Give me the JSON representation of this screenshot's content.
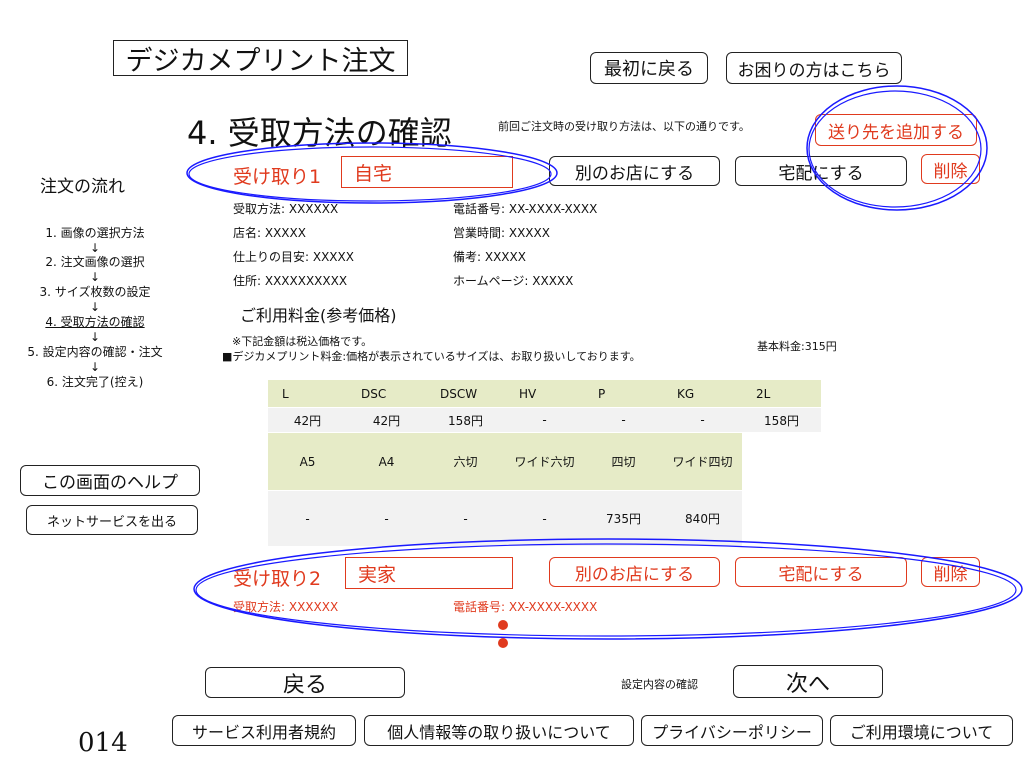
{
  "app": {
    "title": "デジカメプリント注文",
    "page_number": "014"
  },
  "header_nav": {
    "back_to_start": "最初に戻る",
    "help_link": "お困りの方はこちら"
  },
  "page": {
    "heading": "4. 受取方法の確認",
    "note": "前回ご注文時の受け取り方法は、以下の通りです。",
    "add_destination": "送り先を追加する"
  },
  "sidebar": {
    "flow_title": "注文の流れ",
    "steps": [
      "1. 画像の選択方法",
      "2. 注文画像の選択",
      "3. サイズ枚数の設定",
      "4. 受取方法の確認",
      "5. 設定内容の確認・注文",
      "6. 注文完了(控え)"
    ],
    "arrow": "↓",
    "help_button": "この画面のヘルプ",
    "exit_button": "ネットサービスを出る"
  },
  "receipt1": {
    "label": "受け取り1",
    "name_value": "自宅",
    "other_store": "別のお店にする",
    "delivery": "宅配にする",
    "delete": "削除",
    "fields": {
      "method": "受取方法:  XXXXXX",
      "phone": "電話番号:  XX-XXXX-XXXX",
      "store": "店名:  XXXXX",
      "hours": "営業時間:  XXXXX",
      "eta": "仕上りの目安:  XXXXX",
      "remarks": "備考:  XXXXX",
      "address": "住所:  XXXXXXXXXX",
      "homepage": "ホームページ:  XXXXX"
    }
  },
  "pricing": {
    "title": "ご利用料金(参考価格)",
    "note1": "※下記金額は税込価格です。",
    "note2": "■デジカメプリント料金:価格が表示されているサイズは、お取り扱いしております。",
    "base_fee": "基本料金:315円",
    "row1_headers": [
      "L",
      "DSC",
      "DSCW",
      "HV",
      "P",
      "KG",
      "2L"
    ],
    "row1_values": [
      "42円",
      "42円",
      "158円",
      "-",
      "-",
      "-",
      "158円"
    ],
    "row2_headers": [
      "A5",
      "A4",
      "六切",
      "ワイド六切",
      "四切",
      "ワイド四切"
    ],
    "row2_values": [
      "-",
      "-",
      "-",
      "-",
      "735円",
      "840円"
    ]
  },
  "receipt2": {
    "label": "受け取り2",
    "name_value": "実家",
    "other_store": "別のお店にする",
    "delivery": "宅配にする",
    "delete": "削除",
    "method": "受取方法:  XXXXXX",
    "phone": "電話番号:  XX-XXXX-XXXX"
  },
  "footer": {
    "back": "戻る",
    "confirm_label": "設定内容の確認",
    "next": "次へ",
    "links": [
      "サービス利用者規約",
      "個人情報等の取り扱いについて",
      "プライバシーポリシー",
      "ご利用環境について"
    ]
  },
  "colors": {
    "accent_red": "#e03a1e",
    "annotation_blue": "#1a1aff",
    "table_header_bg": "#e6ebc7",
    "table_value_bg": "#f2f2f2"
  }
}
